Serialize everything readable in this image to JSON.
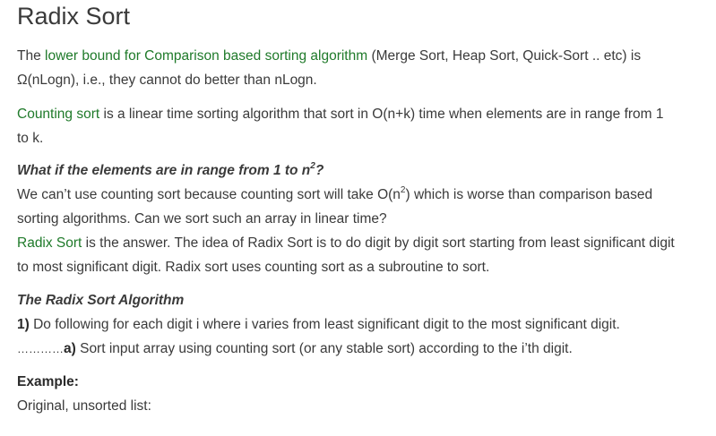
{
  "title": "Radix Sort",
  "p1": {
    "pre": "The ",
    "link": "lower bound for Comparison based sorting algorithm",
    "post1": " (Merge Sort, Heap Sort, Quick-Sort .. etc) is",
    "line2": "Ω(nLogn), i.e., they cannot do better than nLogn."
  },
  "p2": {
    "link": "Counting sort",
    "post1": " is a linear time sorting algorithm that sort in O(n+k) time when elements are in range from 1",
    "line2": "to k."
  },
  "q": {
    "pre": "What if the elements are in range from 1 to n",
    "sup": "2",
    "post": "?"
  },
  "p3": {
    "pre": "We can’t use counting sort because counting sort will take O(n",
    "sup": "2",
    "post": ") which is worse than comparison based",
    "line2": "sorting algorithms. Can we sort such an array in linear time?"
  },
  "p4": {
    "link": "Radix Sort",
    "post1": " is the answer. The idea of Radix Sort is to do digit by digit sort starting from least significant digit",
    "line2": "to most significant digit. Radix sort uses counting sort as a subroutine to sort."
  },
  "algo": {
    "heading": "The Radix Sort Algorithm",
    "step1_num": "1)",
    "step1_text": " Do following for each digit i where i varies from least significant digit to the most significant digit.",
    "step1a_dots": "…………",
    "step1a_label": "a)",
    "step1a_text": " Sort input array using counting sort (or any stable sort) according to the i’th digit."
  },
  "example": {
    "label": "Example:",
    "text": "Original, unsorted list:"
  }
}
